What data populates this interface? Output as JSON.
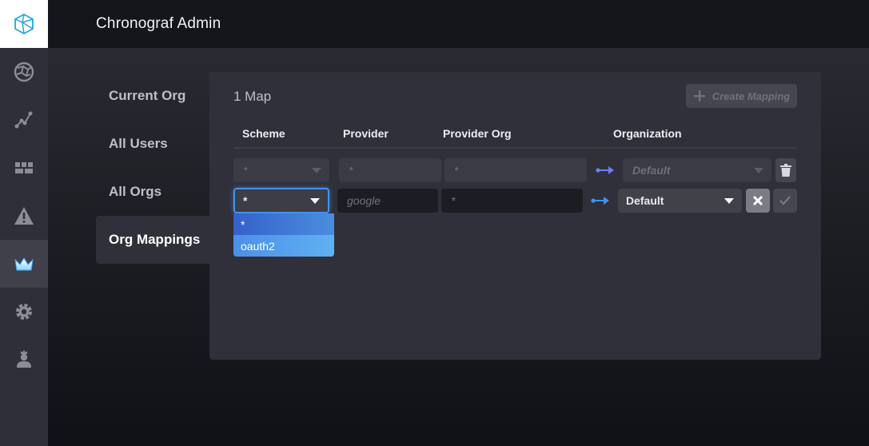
{
  "header": {
    "title": "Chronograf Admin"
  },
  "sidebar": {
    "items": [
      {
        "icon": "logo-icon"
      },
      {
        "icon": "globe-icon"
      },
      {
        "icon": "graph-icon"
      },
      {
        "icon": "dashboards-icon"
      },
      {
        "icon": "alert-triangle-icon"
      },
      {
        "icon": "crown-icon",
        "active": true
      },
      {
        "icon": "gear-icon"
      },
      {
        "icon": "user-icon"
      }
    ]
  },
  "subnav": {
    "items": [
      {
        "label": "Current Org"
      },
      {
        "label": "All Users"
      },
      {
        "label": "All Orgs"
      },
      {
        "label": "Org Mappings",
        "active": true
      }
    ]
  },
  "panel": {
    "title": "1 Map",
    "create_button": "Create Mapping",
    "columns": [
      "Scheme",
      "Provider",
      "Provider Org",
      "Organization"
    ],
    "existing_row": {
      "scheme": "*",
      "provider": "*",
      "provider_org": "*",
      "organization": "Default"
    },
    "new_row": {
      "scheme": "*",
      "provider_placeholder": "google",
      "provider_org_placeholder": "*",
      "organization": "Default"
    },
    "scheme_menu": {
      "options": [
        "*",
        "oauth2"
      ],
      "selected": "*",
      "highlighted": "oauth2"
    }
  },
  "colors": {
    "accent": "#4591ed",
    "arrow": "#6e7ff5",
    "sidebar": "#2e2f38",
    "panel": "#2f3039"
  }
}
